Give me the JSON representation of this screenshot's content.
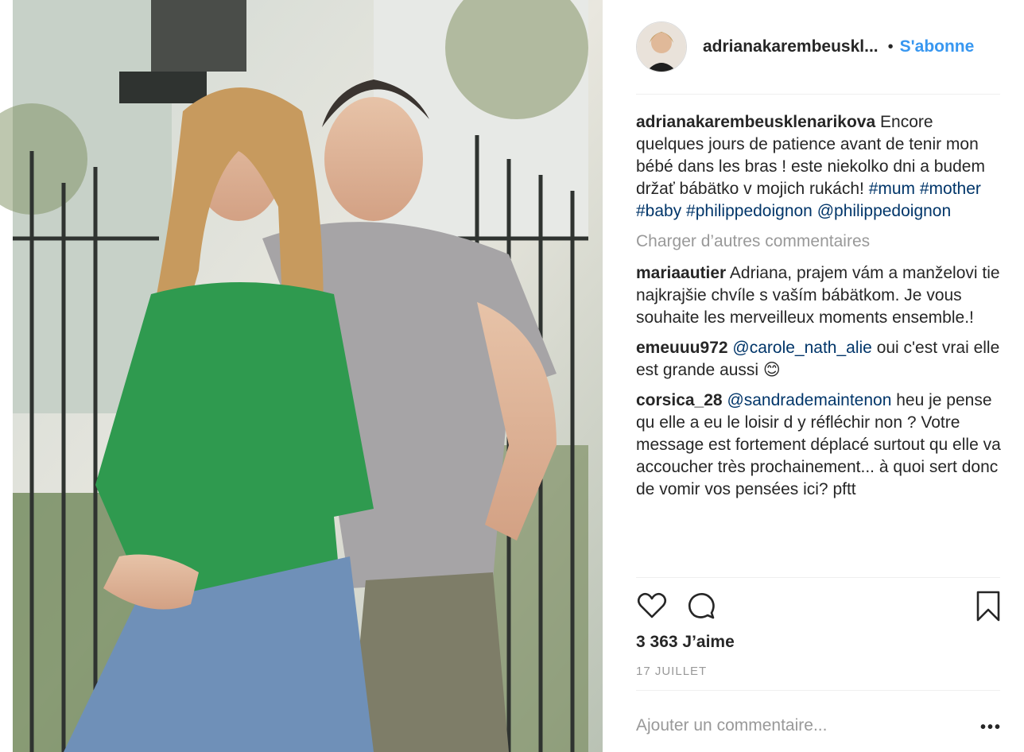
{
  "post": {
    "photo_icon": "photo-couple",
    "author": "adrianakarembeuskl...",
    "dot": "•",
    "follow_label": "S'abonne",
    "colors": {
      "follow": "#3897f0",
      "hashtag": "#003569",
      "muted": "#999999"
    }
  },
  "caption": {
    "user": "adrianakarembeusklenarikova",
    "text": "Encore quelques jours de patience avant de tenir mon bébé dans les bras ! este niekolko dni a budem držať bábätko v mojich rukách!",
    "hashtags": "#mum #mother #baby #philippedoignon",
    "mention": "@philippedoignon"
  },
  "load_more_label": "Charger d’autres commentaires",
  "comments": [
    {
      "user": "mariaautier",
      "mention": "",
      "text": "Adriana, prajem vám a manželovi tie najkrajšie chvíle s vaším bábätkom. Je vous souhaite les merveilleux moments ensemble.!"
    },
    {
      "user": "emeuuu972",
      "mention": "@carole_nath_alie",
      "text": "oui c'est vrai elle est grande aussi 😊"
    },
    {
      "user": "corsica_28",
      "mention": "@sandrademaintenon",
      "text": "heu je pense qu elle a eu le loisir d y réfléchir non ? Votre message est fortement déplacé surtout qu elle va accoucher très prochainement... à quoi sert donc de vomir vos pensées ici? pftt"
    }
  ],
  "actions": {
    "like_icon": "heart-icon",
    "comment_icon": "speech-bubble-icon",
    "save_icon": "bookmark-icon"
  },
  "likes_label": "3 363 J’aime",
  "date_label": "17 JUILLET",
  "add_comment": {
    "placeholder": "Ajouter un commentaire...",
    "more_label": "•••"
  }
}
